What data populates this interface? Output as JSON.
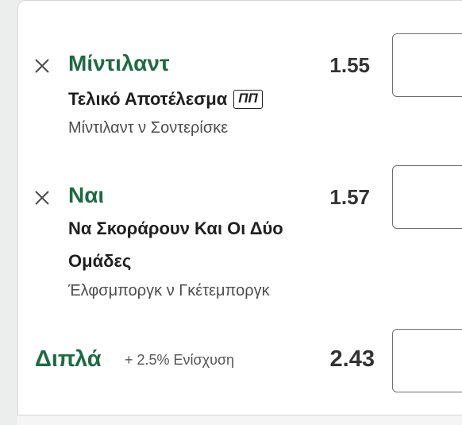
{
  "selections": [
    {
      "name": "Μίντιλαντ",
      "market": "Τελικό Αποτέλεσμα",
      "badge": "ΠΠ",
      "event": "Μίντιλαντ ν Σοντερίσκε",
      "odds": "1.55"
    },
    {
      "name": "Ναι",
      "market_line1": "Να Σκοράρουν Και Οι Δύο",
      "market_line2": "Ομάδες",
      "event": "Έλφσμποργκ ν Γκέτεμποργκ",
      "odds": "1.57"
    }
  ],
  "double": {
    "label": "Διπλά",
    "boost": "+ 2.5% Ενίσχυση",
    "odds": "2.43"
  },
  "icons": {
    "remove": "close-icon"
  },
  "colors": {
    "accent": "#1e6b43",
    "text": "#1f1f1f",
    "muted": "#4d4d4d"
  }
}
